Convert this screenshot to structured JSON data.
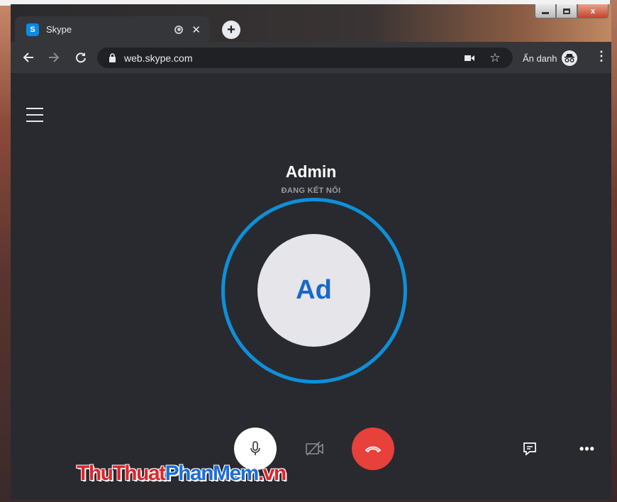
{
  "tab": {
    "favicon": "S",
    "title": "Skype"
  },
  "address_bar": {
    "url": "web.skype.com"
  },
  "incognito": {
    "label": "Ẩn danh"
  },
  "call": {
    "name": "Admin",
    "status": "ĐANG KẾT NỐI",
    "avatar_initials": "Ad"
  },
  "window_controls": {
    "close": "x"
  },
  "watermark": {
    "part1": "ThuThuat",
    "part2": "PhanMem",
    "part3": ".vn"
  },
  "colors": {
    "ring": "#0f8fd9",
    "avatar_text": "#1769c6",
    "end_call": "#e8403a",
    "background": "#292a2f"
  },
  "icons": [
    "skype-icon",
    "audio-playing-icon",
    "close-icon",
    "plus-icon",
    "back-arrow-icon",
    "forward-arrow-icon",
    "reload-icon",
    "lock-icon",
    "camera-icon",
    "star-icon",
    "incognito-icon",
    "kebab-menu-icon",
    "hamburger-menu-icon",
    "microphone-icon",
    "video-off-icon",
    "hang-up-icon",
    "chat-icon",
    "more-options-icon"
  ]
}
